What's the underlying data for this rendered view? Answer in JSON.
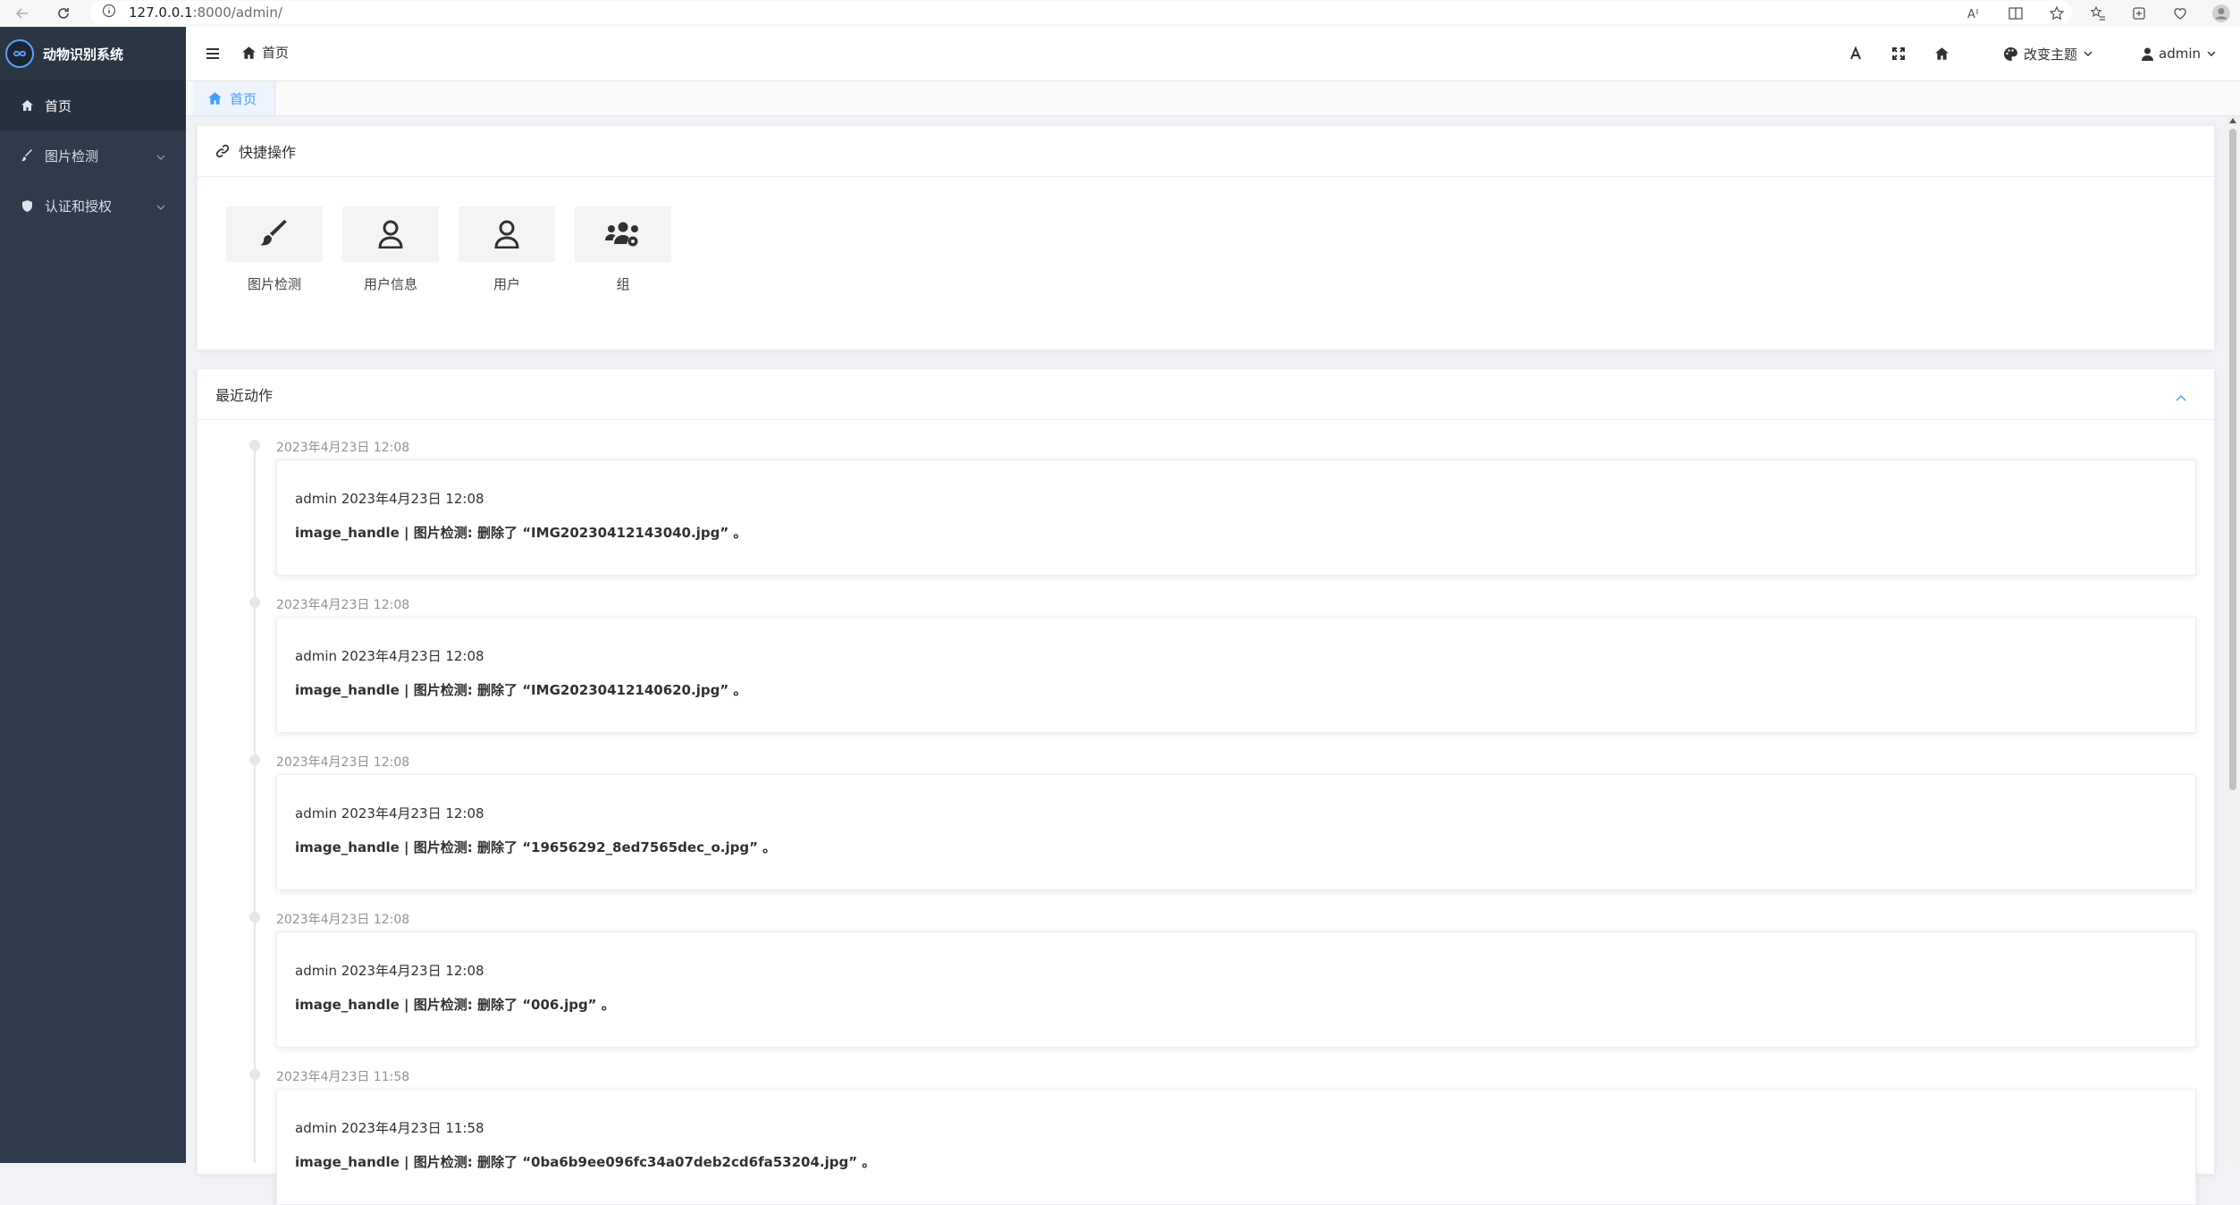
{
  "browser": {
    "url_host": "127.0.0.1",
    "url_rest": ":8000/admin/"
  },
  "sidebar": {
    "brand": "动物识别系统",
    "items": [
      {
        "label": "首页",
        "icon": "home-icon",
        "active": true
      },
      {
        "label": "图片检测",
        "icon": "brush-icon",
        "expandable": true
      },
      {
        "label": "认证和授权",
        "icon": "shield-icon",
        "expandable": true
      }
    ]
  },
  "header": {
    "breadcrumb": "首页",
    "theme_label": "改变主题",
    "user_label": "admin"
  },
  "tabs": {
    "home": "首页"
  },
  "quick_actions": {
    "title": "快捷操作",
    "items": [
      {
        "label": "图片检测",
        "icon": "brush-icon"
      },
      {
        "label": "用户信息",
        "icon": "user-icon"
      },
      {
        "label": "用户",
        "icon": "user-icon"
      },
      {
        "label": "组",
        "icon": "users-cog-icon"
      }
    ]
  },
  "recent": {
    "title": "最近动作",
    "entries": [
      {
        "time": "2023年4月23日 12:08",
        "who": "admin 2023年4月23日 12:08",
        "msg": "image_handle | 图片检测: 删除了 “IMG20230412143040.jpg” 。"
      },
      {
        "time": "2023年4月23日 12:08",
        "who": "admin 2023年4月23日 12:08",
        "msg": "image_handle | 图片检测: 删除了 “IMG20230412140620.jpg” 。"
      },
      {
        "time": "2023年4月23日 12:08",
        "who": "admin 2023年4月23日 12:08",
        "msg": "image_handle | 图片检测: 删除了 “19656292_8ed7565dec_o.jpg” 。"
      },
      {
        "time": "2023年4月23日 12:08",
        "who": "admin 2023年4月23日 12:08",
        "msg": "image_handle | 图片检测: 删除了 “006.jpg” 。"
      },
      {
        "time": "2023年4月23日 11:58",
        "who": "admin 2023年4月23日 11:58",
        "msg": "image_handle | 图片检测: 删除了 “0ba6b9ee096fc34a07deb2cd6fa53204.jpg” 。"
      }
    ]
  },
  "colors": {
    "sidebar_bg": "#2f3b4c",
    "accent": "#409eff"
  }
}
